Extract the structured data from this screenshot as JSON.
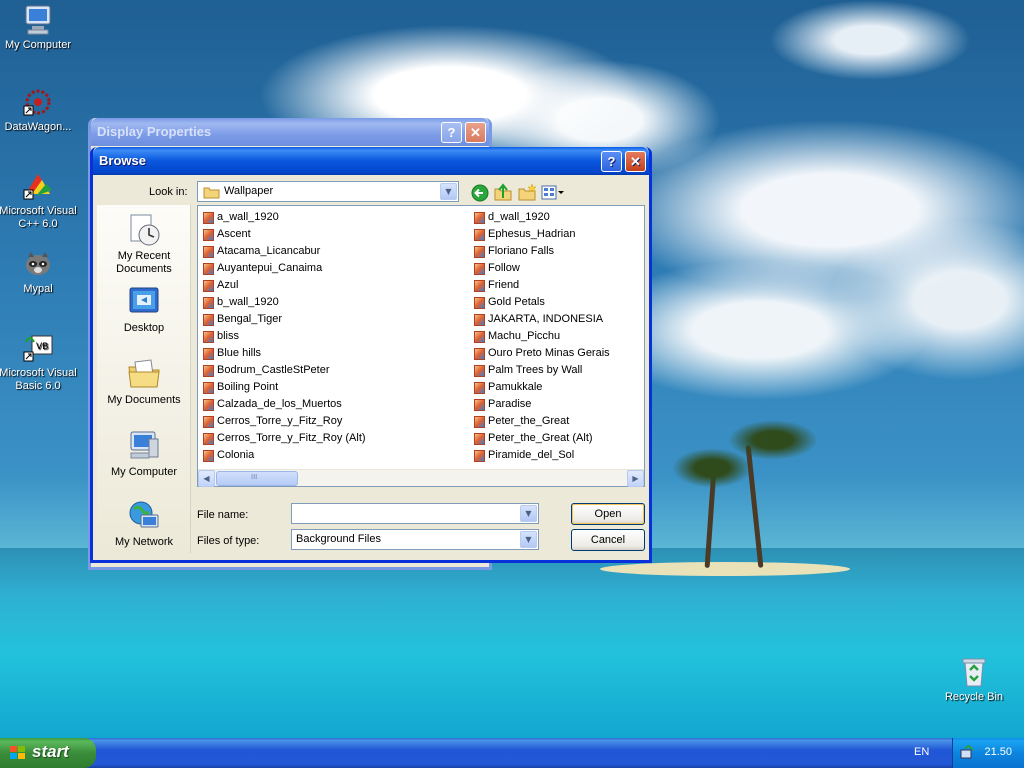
{
  "desktop": {
    "icons": [
      {
        "label": "My Computer"
      },
      {
        "label": "DataWagon..."
      },
      {
        "label": "Microsoft Visual C++ 6.0"
      },
      {
        "label": "Mypal"
      },
      {
        "label": "Microsoft Visual Basic 6.0"
      },
      {
        "label": "Recycle Bin"
      }
    ]
  },
  "display_properties": {
    "title": "Display Properties",
    "help_glyph": "?",
    "close_glyph": "✕"
  },
  "browse": {
    "title": "Browse",
    "help_glyph": "?",
    "close_glyph": "✕",
    "look_in_label": "Look in:",
    "look_in_value": "Wallpaper",
    "places": [
      {
        "label": "My Recent Documents"
      },
      {
        "label": "Desktop"
      },
      {
        "label": "My Documents"
      },
      {
        "label": "My Computer"
      },
      {
        "label": "My Network"
      }
    ],
    "files_col1": [
      "a_wall_1920",
      "Ascent",
      "Atacama_Licancabur",
      "Auyantepui_Canaima",
      "Azul",
      "b_wall_1920",
      "Bengal_Tiger",
      "bliss",
      "Blue hills",
      "Bodrum_CastleStPeter",
      "Boiling Point",
      "Calzada_de_los_Muertos",
      "Cerros_Torre_y_Fitz_Roy",
      "Cerros_Torre_y_Fitz_Roy (Alt)",
      "Colonia"
    ],
    "files_col2": [
      "d_wall_1920",
      "Ephesus_Hadrian",
      "Floriano Falls",
      "Follow",
      "Friend",
      "Gold Petals",
      "JAKARTA, INDONESIA",
      "Machu_Picchu",
      "Ouro Preto Minas Gerais",
      "Palm Trees by Wall",
      "Pamukkale",
      "Paradise",
      "Peter_the_Great",
      "Peter_the_Great (Alt)",
      "Piramide_del_Sol"
    ],
    "file_name_label": "File name:",
    "file_name_value": "",
    "files_of_type_label": "Files of type:",
    "files_of_type_value": "Background Files",
    "open_label": "Open",
    "cancel_label": "Cancel",
    "scroll_thumb_glyph": "III"
  },
  "taskbar": {
    "start_label": "start",
    "language": "EN",
    "clock": "21.50"
  }
}
